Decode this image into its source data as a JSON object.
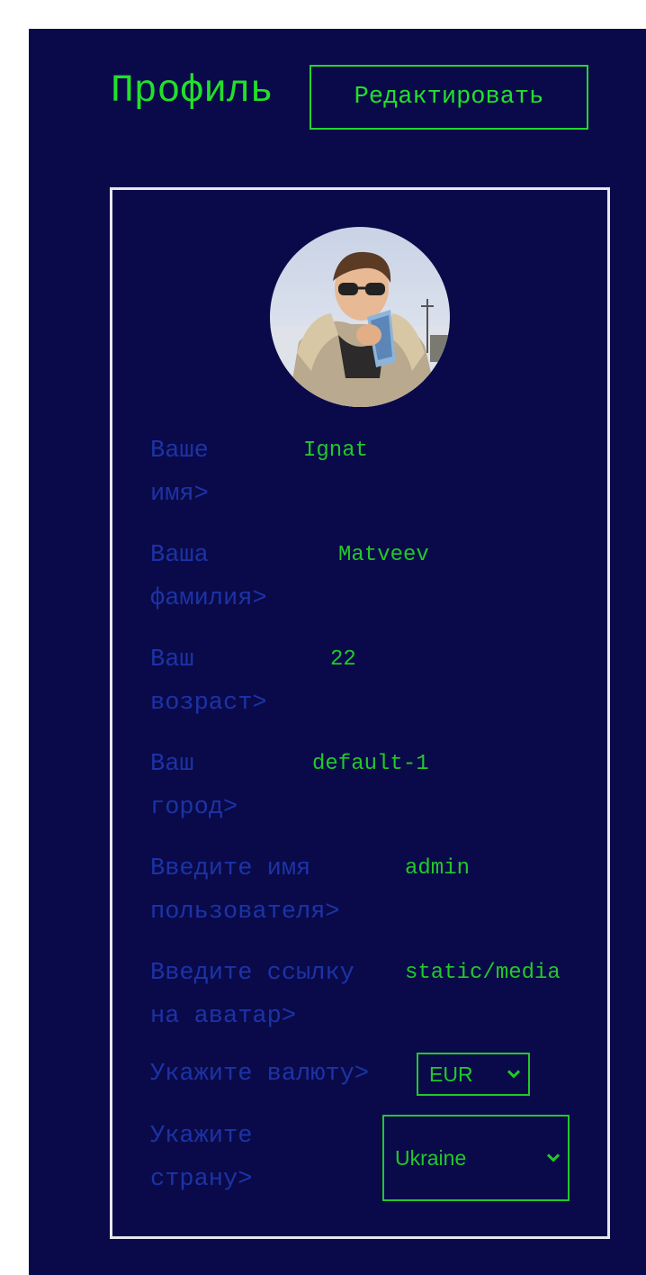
{
  "header": {
    "title": "Профиль",
    "edit_label": "Редактировать"
  },
  "profile": {
    "fields": [
      {
        "label": "Ваше\nимя>",
        "value": "Ignat"
      },
      {
        "label": "Ваша\nфамилия>",
        "value": "Matveev"
      },
      {
        "label": "Ваш\nвозраст>",
        "value": "22"
      },
      {
        "label": "Ваш\nгород>",
        "value": "default-1"
      },
      {
        "label": "Введите имя\nпользователя>",
        "value": "admin"
      },
      {
        "label": "Введите ссылку\nна аватар>",
        "value": "static/media"
      }
    ],
    "currency": {
      "label": "Укажите валюту>",
      "value": "EUR"
    },
    "country": {
      "label": "Укажите\nстрану>",
      "value": "Ukraine"
    }
  },
  "colors": {
    "background": "#0a0a4a",
    "accent_green": "#22e02a",
    "label_blue": "#1c33a6",
    "card_border": "#e6e6ee"
  },
  "icons": {
    "select_chevron": "chevron-down-icon",
    "avatar": "user-photo"
  }
}
